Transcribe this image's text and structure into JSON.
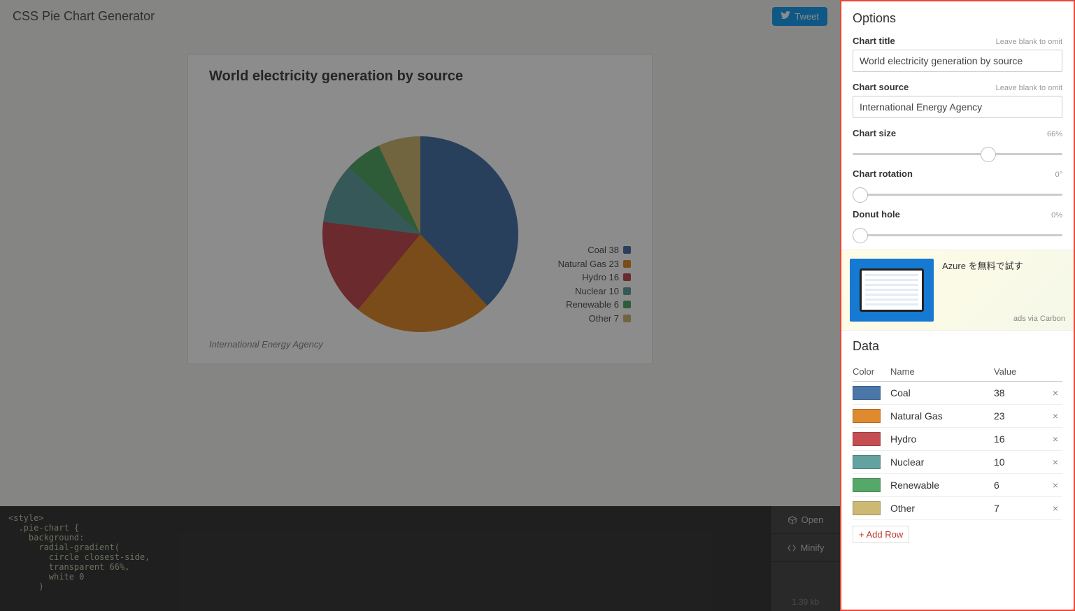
{
  "app_title": "CSS Pie Chart Generator",
  "tweet_label": "Tweet",
  "chart_data": {
    "type": "pie",
    "title": "World electricity generation by source",
    "source": "International Energy Agency",
    "series": [
      {
        "name": "Coal",
        "value": 38,
        "color": "#4a76a8"
      },
      {
        "name": "Natural Gas",
        "value": 23,
        "color": "#df8a2e"
      },
      {
        "name": "Hydro",
        "value": 16,
        "color": "#c44e52"
      },
      {
        "name": "Nuclear",
        "value": 10,
        "color": "#64a1a1"
      },
      {
        "name": "Renewable",
        "value": 6,
        "color": "#55a868"
      },
      {
        "name": "Other",
        "value": 7,
        "color": "#ccb974"
      }
    ]
  },
  "options": {
    "heading": "Options",
    "chart_title": {
      "label": "Chart title",
      "hint": "Leave blank to omit",
      "value": "World electricity generation by source"
    },
    "chart_source": {
      "label": "Chart source",
      "hint": "Leave blank to omit",
      "value": "International Energy Agency"
    },
    "chart_size": {
      "label": "Chart size",
      "value": 66,
      "display": "66%"
    },
    "chart_rotation": {
      "label": "Chart rotation",
      "value": 0,
      "display": "0°"
    },
    "donut_hole": {
      "label": "Donut hole",
      "value": 0,
      "display": "0%"
    }
  },
  "ad": {
    "text": "Azure を無料で試す",
    "via": "ads via Carbon"
  },
  "data_section": {
    "heading": "Data",
    "columns": {
      "color": "Color",
      "name": "Name",
      "value": "Value"
    },
    "rows": [
      {
        "color": "#4a76a8",
        "name": "Coal",
        "value": "38"
      },
      {
        "color": "#df8a2e",
        "name": "Natural Gas",
        "value": "23"
      },
      {
        "color": "#c44e52",
        "name": "Hydro",
        "value": "16"
      },
      {
        "color": "#64a1a1",
        "name": "Nuclear",
        "value": "10"
      },
      {
        "color": "#55a868",
        "name": "Renewable",
        "value": "6"
      },
      {
        "color": "#ccb974",
        "name": "Other",
        "value": "7"
      }
    ],
    "add_row_label": "+ Add Row"
  },
  "code": {
    "open_label": "Open",
    "minify_label": "Minify",
    "size": "1.39 kb",
    "text": "<style>\n  .pie-chart {\n    background:\n      radial-gradient(\n        circle closest-side,\n        transparent 66%,\n        white 0\n      )"
  }
}
